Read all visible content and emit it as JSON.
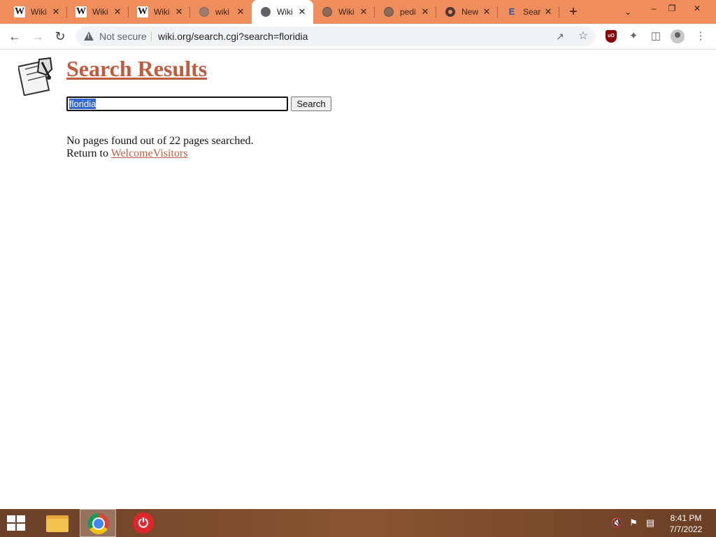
{
  "browser": {
    "tabs": [
      {
        "title": "Wiki",
        "favicon": "wikipedia-w-icon",
        "active": false
      },
      {
        "title": "Wiki",
        "favicon": "wikipedia-w-icon",
        "active": false
      },
      {
        "title": "Wiki",
        "favicon": "wikipedia-w-icon",
        "active": false
      },
      {
        "title": "wiki",
        "favicon": "globe-icon",
        "active": false
      },
      {
        "title": "Wiki",
        "favicon": "globe-icon",
        "active": true
      },
      {
        "title": "Wiki",
        "favicon": "globe-icon",
        "active": false
      },
      {
        "title": "pedi",
        "favicon": "globe-icon",
        "active": false
      },
      {
        "title": "New",
        "favicon": "chrome-icon",
        "active": false
      },
      {
        "title": "Sear",
        "favicon": "e-logo-icon",
        "active": false
      }
    ],
    "tab_close_glyph": "✕",
    "new_tab_glyph": "+",
    "security_label": "Not secure",
    "url": "wiki.org/search.cgi?search=floridia",
    "accent_color": "#ef8e5c"
  },
  "page": {
    "title": "Search Results",
    "search_value": "floridia",
    "search_button": "Search",
    "message": "No pages found out of 22 pages searched.",
    "return_prefix": "Return to ",
    "return_link": "WelcomeVisitors",
    "link_color": "#c15b3e"
  },
  "taskbar": {
    "time": "8:41 PM",
    "date": "7/7/2022"
  }
}
